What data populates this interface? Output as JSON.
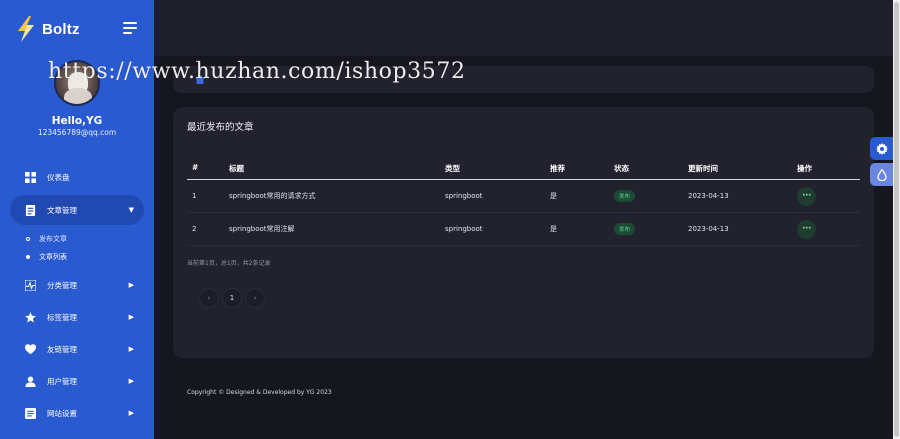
{
  "brand": {
    "name": "Boltz"
  },
  "user": {
    "greeting": "Hello,YG",
    "email": "123456789@qq.com"
  },
  "nav": {
    "dashboard": "仪表盘",
    "articles": "文章管理",
    "articles_sub": [
      "发布文章",
      "文章列表"
    ],
    "categories": "分类管理",
    "tags": "标签管理",
    "links": "友链管理",
    "users": "用户管理",
    "site": "网站设置"
  },
  "card": {
    "title": "最近发布的文章",
    "columns": [
      "#",
      "标题",
      "类型",
      "推荐",
      "状态",
      "更新时间",
      "操作"
    ],
    "rows": [
      {
        "id": "1",
        "title": "springboot常用的请求方式",
        "type": "springboot",
        "recommended": "是",
        "status": "发布",
        "updated": "2023-04-13",
        "action": "···"
      },
      {
        "id": "2",
        "title": "springboot常用注解",
        "type": "springboot",
        "recommended": "是",
        "status": "发布",
        "updated": "2023-04-13",
        "action": "···"
      }
    ],
    "page_info": "当前第1页，总1页，共2条记录",
    "pager": {
      "prev": "‹",
      "current": "1",
      "next": "›"
    }
  },
  "footer": "Copyright © Designed & Developed by YG 2023",
  "watermark": "https://www.huzhan.com/ishop3572",
  "colors": {
    "sidebar": "#2a5ad0",
    "sidebar_active": "#2149b2",
    "page_bg": "#16161f",
    "card_bg": "#22222f",
    "status_green": "#5fd68f"
  },
  "icons": {
    "brand": "lightning-bolt-icon",
    "toggle": "hamburger-menu-icon",
    "dashboard": "grid-icon",
    "articles": "document-icon",
    "categories": "pulse-icon",
    "tags": "star-icon",
    "links": "heart-icon",
    "users": "user-icon",
    "site": "settings-list-icon",
    "float1": "gear-icon",
    "float2": "drop-icon"
  }
}
